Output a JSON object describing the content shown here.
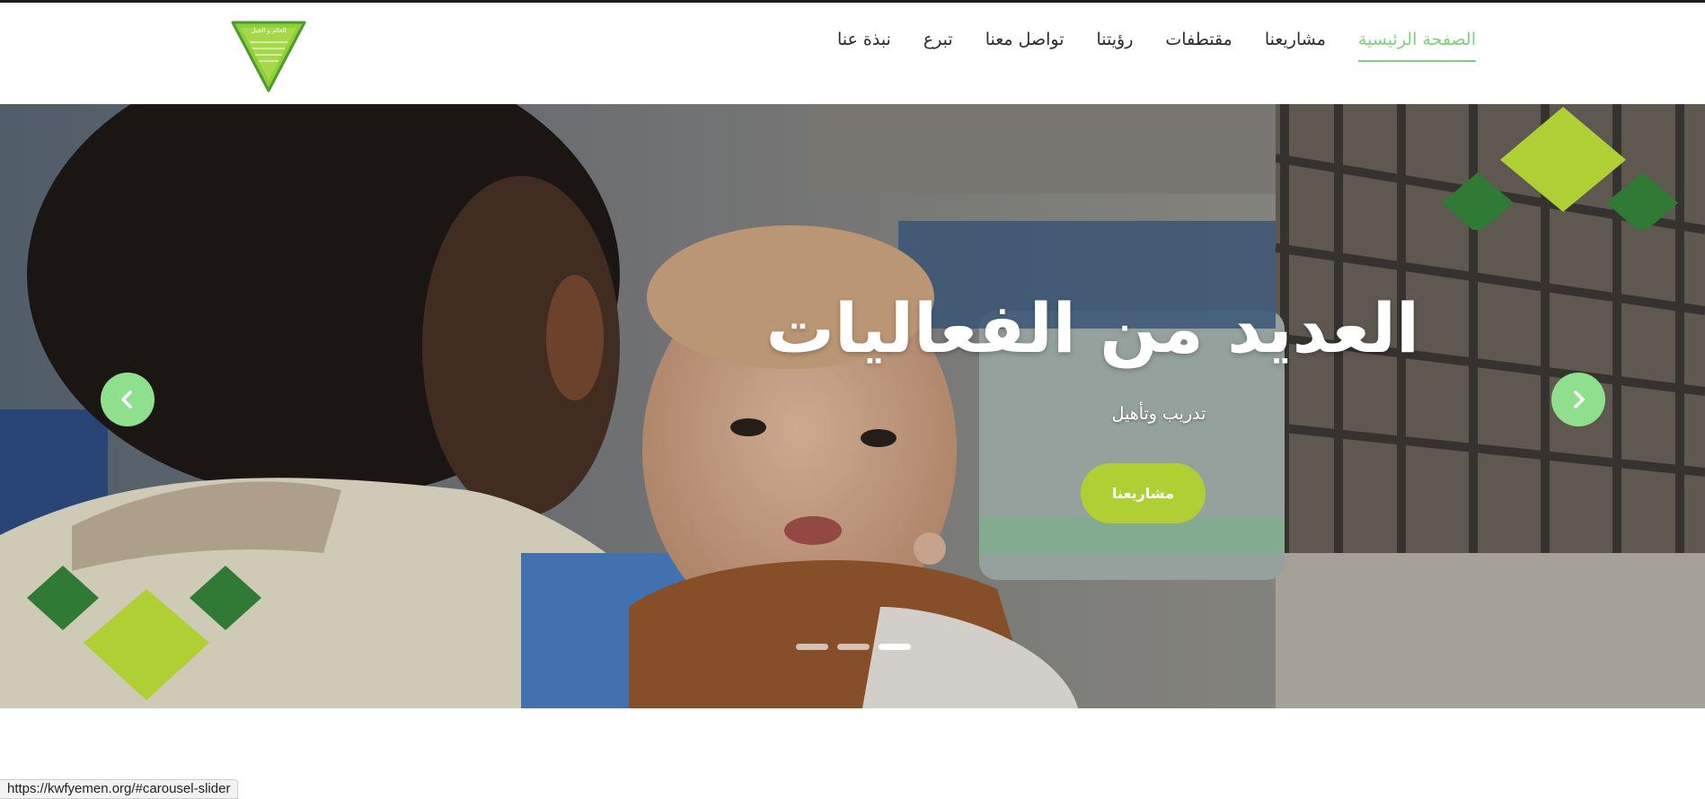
{
  "header": {
    "logo": {
      "text": "الحلم و الجيل"
    },
    "nav": [
      {
        "label": "الصفحة الرئيسية",
        "active": true
      },
      {
        "label": "مشاريعنا",
        "active": false
      },
      {
        "label": "مقتطفات",
        "active": false
      },
      {
        "label": "رؤيتنا",
        "active": false
      },
      {
        "label": "تواصل معنا",
        "active": false
      },
      {
        "label": "تبرع",
        "active": false
      },
      {
        "label": "نبذة عنا",
        "active": false
      }
    ]
  },
  "hero": {
    "title": "العديد من الفعاليات",
    "subtitle": "تدريب وتأهيل",
    "button_label": "مشاريعنا",
    "prev_icon": "chevron-left-icon",
    "next_icon": "chevron-right-icon",
    "slides_count": 3,
    "active_slide": 3
  },
  "status_bar": {
    "url": "https://kwfyemen.org/#carousel-slider"
  },
  "colors": {
    "accent_green": "#7fd17e",
    "lime": "#b0cf34",
    "dark_green": "#2f7a34",
    "arrow_bg": "#8fe08c"
  }
}
